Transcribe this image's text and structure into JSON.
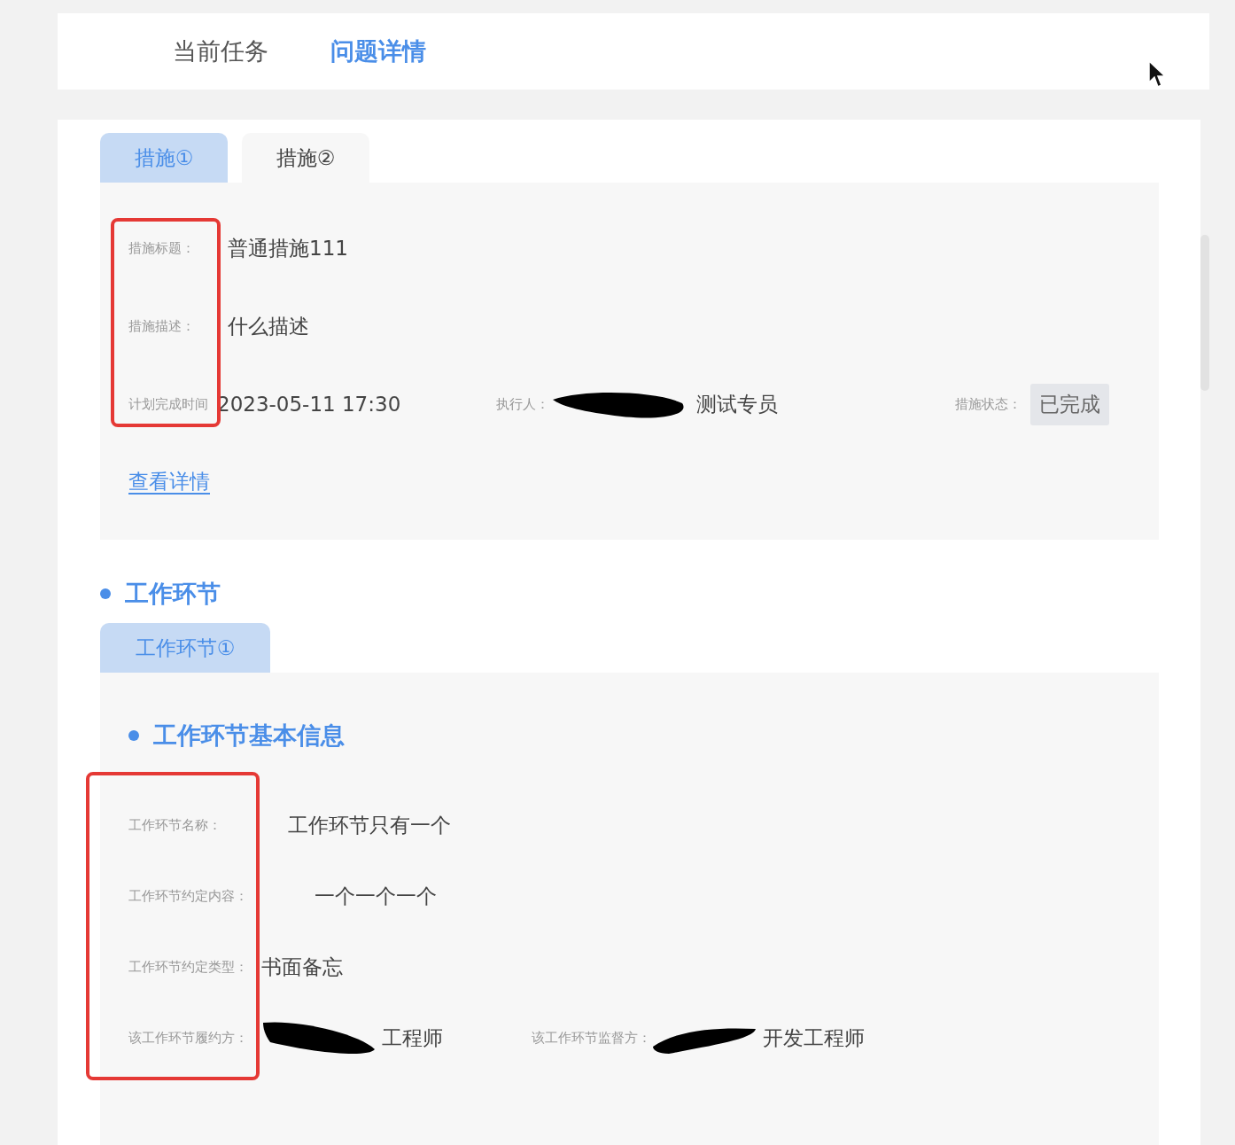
{
  "top_tabs": [
    {
      "label": "当前任务",
      "selected": false
    },
    {
      "label": "问题详情",
      "selected": true
    }
  ],
  "measure_tabs": [
    {
      "label": "措施①",
      "selected": true
    },
    {
      "label": "措施②",
      "selected": false
    }
  ],
  "measure": {
    "title_label": "措施标题：",
    "title": "普通措施111",
    "desc_label": "措施描述：",
    "desc": "什么描述",
    "time_label": "计划完成时间",
    "time": "2023-05-11 17:30",
    "executor_label": "执行人：",
    "executor": "测试专员",
    "status_label": "措施状态：",
    "status": "已完成",
    "detail_link": "查看详情"
  },
  "work_section": {
    "heading": "工作环节",
    "tabs": [
      {
        "label": "工作环节①",
        "selected": true
      }
    ],
    "subheading": "工作环节基本信息",
    "fields": [
      {
        "label": "工作环节名称：",
        "value": "工作环节只有一个"
      },
      {
        "label": "工作环节约定内容：",
        "value": "一个一个一个"
      },
      {
        "label": "工作环节约定类型：",
        "value": "书面备忘"
      }
    ],
    "performer_label": "该工作环节履约方：",
    "performer": "工程师",
    "supervisor_label": "该工作环节监督方：",
    "supervisor": "开发工程师"
  }
}
